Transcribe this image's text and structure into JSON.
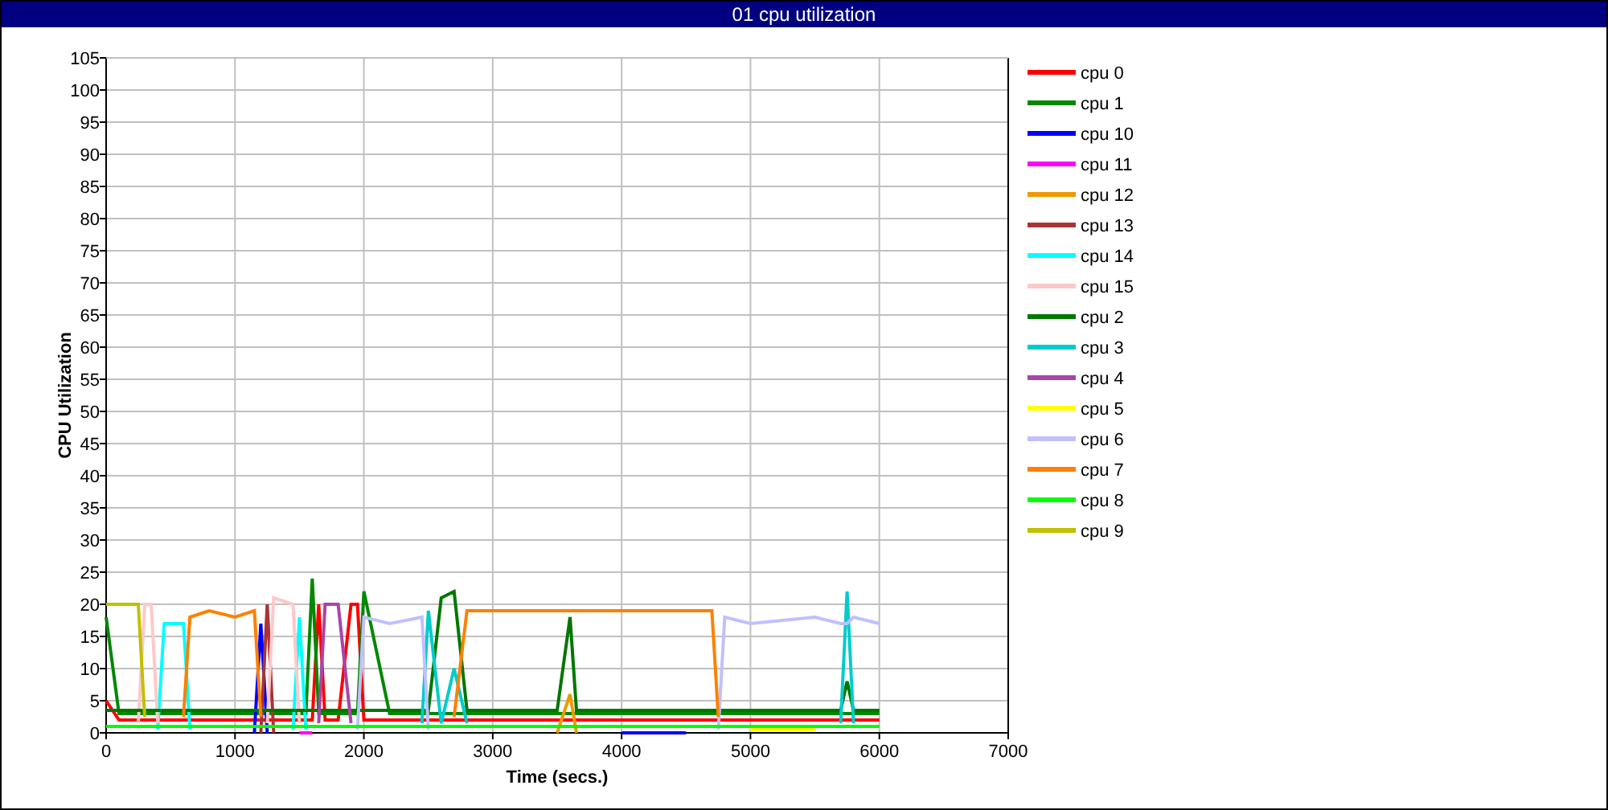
{
  "window": {
    "title": "01 cpu utilization"
  },
  "chart": {
    "chart_data": {
      "type": "line",
      "xlabel": "Time (secs.)",
      "ylabel": "CPU Utilization",
      "x": [
        0,
        100,
        250,
        300,
        350,
        400,
        450,
        600,
        650,
        800,
        1000,
        1150,
        1200,
        1250,
        1300,
        1450,
        1500,
        1550,
        1600,
        1650,
        1700,
        1800,
        1900,
        1950,
        2000,
        2200,
        2450,
        2500,
        2600,
        2700,
        2800,
        3000,
        3500,
        3600,
        3650,
        4000,
        4500,
        4700,
        4750,
        4800,
        5000,
        5500,
        5700,
        5750,
        5800,
        6000
      ],
      "xlim": [
        0,
        7000
      ],
      "ylim": [
        0,
        105
      ],
      "xticks": [
        0,
        1000,
        2000,
        3000,
        4000,
        5000,
        6000,
        7000
      ],
      "yticks": [
        0,
        5,
        10,
        15,
        20,
        25,
        30,
        35,
        40,
        45,
        50,
        55,
        60,
        65,
        70,
        75,
        80,
        85,
        90,
        95,
        100,
        105
      ],
      "grid": true,
      "legend": "right",
      "series": [
        {
          "name": "cpu 0",
          "color": "#ff0000",
          "values": [
            5,
            2,
            2,
            2,
            2,
            2,
            2,
            2,
            2,
            2,
            2,
            2,
            2,
            2,
            2,
            2,
            2,
            2,
            2,
            20,
            2,
            2,
            20,
            20,
            2,
            2,
            2,
            2,
            2,
            2,
            2,
            2,
            2,
            2,
            2,
            2,
            2,
            2,
            2,
            2,
            2,
            2,
            2,
            2,
            2,
            2
          ]
        },
        {
          "name": "cpu 1",
          "color": "#008800",
          "values": [
            18,
            3,
            3,
            3,
            3,
            3,
            3,
            3,
            3,
            3,
            3,
            3,
            3,
            3,
            3,
            3,
            3,
            3,
            24,
            3,
            3,
            3,
            3,
            3,
            22,
            3,
            3,
            3,
            3,
            3,
            3,
            3,
            3,
            3,
            3,
            3,
            3,
            3,
            3,
            3,
            3,
            3,
            3,
            3,
            3,
            3
          ]
        },
        {
          "name": "cpu 10",
          "color": "#0000ff",
          "values": [
            null,
            null,
            null,
            null,
            null,
            null,
            null,
            null,
            null,
            null,
            null,
            0,
            17,
            0,
            null,
            null,
            null,
            null,
            null,
            null,
            null,
            null,
            null,
            null,
            null,
            null,
            null,
            null,
            null,
            null,
            null,
            null,
            null,
            null,
            null,
            0,
            0,
            null,
            null,
            null,
            null,
            null,
            null,
            null,
            null,
            null
          ]
        },
        {
          "name": "cpu 11",
          "color": "#ff00ff",
          "values": [
            null,
            null,
            null,
            null,
            null,
            null,
            null,
            null,
            null,
            null,
            null,
            null,
            null,
            null,
            null,
            null,
            0,
            0,
            0,
            null,
            null,
            null,
            null,
            null,
            null,
            null,
            null,
            null,
            null,
            null,
            null,
            null,
            null,
            null,
            null,
            null,
            null,
            null,
            null,
            null,
            null,
            null,
            null,
            null,
            null,
            null
          ]
        },
        {
          "name": "cpu 12",
          "color": "#ee9900",
          "values": [
            null,
            null,
            null,
            null,
            null,
            null,
            null,
            null,
            null,
            null,
            null,
            null,
            null,
            null,
            null,
            null,
            null,
            null,
            null,
            null,
            null,
            null,
            null,
            null,
            null,
            null,
            null,
            null,
            null,
            null,
            null,
            null,
            0,
            6,
            0,
            null,
            null,
            null,
            null,
            null,
            null,
            null,
            null,
            null,
            null,
            null
          ]
        },
        {
          "name": "cpu 13",
          "color": "#aa3333",
          "values": [
            null,
            null,
            null,
            null,
            null,
            null,
            null,
            null,
            null,
            null,
            null,
            null,
            0,
            20,
            0,
            null,
            null,
            null,
            null,
            null,
            null,
            null,
            null,
            null,
            null,
            null,
            null,
            null,
            null,
            null,
            null,
            null,
            null,
            null,
            null,
            null,
            null,
            null,
            null,
            null,
            null,
            null,
            null,
            null,
            null,
            null
          ]
        },
        {
          "name": "cpu 14",
          "color": "#00ffff",
          "values": [
            null,
            null,
            null,
            null,
            null,
            0.5,
            17,
            17,
            0.5,
            null,
            null,
            null,
            null,
            null,
            null,
            0.5,
            18,
            0.5,
            null,
            null,
            null,
            null,
            null,
            null,
            null,
            null,
            null,
            null,
            null,
            null,
            null,
            null,
            null,
            null,
            null,
            null,
            null,
            null,
            null,
            null,
            null,
            null,
            null,
            null,
            null,
            null
          ]
        },
        {
          "name": "cpu 15",
          "color": "#ffc8c8",
          "values": [
            null,
            null,
            1.5,
            20,
            20,
            1.5,
            null,
            null,
            null,
            null,
            null,
            null,
            null,
            1.5,
            21,
            20,
            1.5,
            null,
            null,
            null,
            null,
            null,
            null,
            null,
            null,
            null,
            null,
            null,
            null,
            null,
            null,
            null,
            null,
            null,
            null,
            null,
            null,
            null,
            null,
            null,
            null,
            null,
            null,
            null,
            null,
            null
          ]
        },
        {
          "name": "cpu 2",
          "color": "#007700",
          "values": [
            3.5,
            3.5,
            3.5,
            3.5,
            3.5,
            3.5,
            3.5,
            3.5,
            3.5,
            3.5,
            3.5,
            3.5,
            3.5,
            3.5,
            3.5,
            3.5,
            3.5,
            3.5,
            3.5,
            3.5,
            3.5,
            3.5,
            3.5,
            3.5,
            3.5,
            3.5,
            3.5,
            3.5,
            21,
            22,
            3.5,
            3.5,
            3.5,
            18,
            3.5,
            3.5,
            3.5,
            3.5,
            3.5,
            3.5,
            3.5,
            3.5,
            3.5,
            8,
            3.5,
            3.5
          ]
        },
        {
          "name": "cpu 3",
          "color": "#00cccc",
          "values": [
            null,
            null,
            null,
            null,
            null,
            null,
            null,
            null,
            null,
            null,
            null,
            null,
            null,
            null,
            null,
            null,
            null,
            null,
            null,
            null,
            null,
            null,
            null,
            null,
            null,
            null,
            1.5,
            19,
            1.5,
            10,
            1.5,
            null,
            null,
            null,
            null,
            null,
            null,
            null,
            null,
            null,
            null,
            null,
            1.5,
            22,
            1.5,
            null
          ]
        },
        {
          "name": "cpu 4",
          "color": "#aa44aa",
          "values": [
            null,
            null,
            null,
            null,
            null,
            null,
            null,
            null,
            null,
            null,
            null,
            null,
            null,
            null,
            null,
            null,
            null,
            null,
            null,
            1.5,
            20,
            20,
            1.5,
            null,
            null,
            null,
            null,
            null,
            null,
            null,
            null,
            null,
            null,
            null,
            null,
            null,
            null,
            null,
            null,
            null,
            null,
            null,
            null,
            null,
            null,
            null
          ]
        },
        {
          "name": "cpu 5",
          "color": "#ffff00",
          "values": [
            null,
            null,
            null,
            null,
            null,
            null,
            null,
            null,
            null,
            null,
            null,
            null,
            null,
            null,
            null,
            null,
            null,
            null,
            null,
            null,
            null,
            null,
            null,
            null,
            null,
            null,
            null,
            null,
            null,
            null,
            null,
            null,
            null,
            null,
            null,
            null,
            null,
            null,
            null,
            null,
            0.5,
            0.5,
            null,
            null,
            null,
            null
          ]
        },
        {
          "name": "cpu 6",
          "color": "#c0c0ff",
          "values": [
            null,
            null,
            null,
            null,
            null,
            null,
            null,
            null,
            null,
            null,
            null,
            null,
            null,
            null,
            null,
            null,
            null,
            null,
            null,
            null,
            null,
            null,
            null,
            0.5,
            18,
            17,
            18,
            0.5,
            null,
            null,
            null,
            null,
            null,
            null,
            null,
            null,
            null,
            null,
            0.5,
            18,
            17,
            18,
            17,
            17,
            18,
            17
          ]
        },
        {
          "name": "cpu 7",
          "color": "#ff8000",
          "values": [
            null,
            null,
            null,
            null,
            null,
            null,
            null,
            2.5,
            18,
            19,
            18,
            19,
            2.5,
            null,
            null,
            null,
            null,
            null,
            null,
            null,
            null,
            null,
            null,
            null,
            null,
            null,
            null,
            null,
            null,
            2.5,
            19,
            19,
            19,
            19,
            19,
            19,
            19,
            19,
            2.5,
            null,
            null,
            null,
            null,
            null,
            null,
            null
          ]
        },
        {
          "name": "cpu 8",
          "color": "#00ff00",
          "values": [
            1,
            1,
            1,
            1,
            1,
            1,
            1,
            1,
            1,
            1,
            1,
            1,
            1,
            1,
            1,
            1,
            1,
            1,
            1,
            1,
            1,
            1,
            1,
            1,
            1,
            1,
            1,
            1,
            1,
            1,
            1,
            1,
            1,
            1,
            1,
            1,
            1,
            1,
            1,
            1,
            1,
            1,
            1,
            1,
            1,
            1
          ]
        },
        {
          "name": "cpu 9",
          "color": "#c0c000",
          "values": [
            20,
            20,
            20,
            2.5,
            null,
            null,
            null,
            null,
            null,
            null,
            null,
            null,
            null,
            null,
            null,
            null,
            null,
            null,
            null,
            null,
            null,
            null,
            null,
            null,
            null,
            null,
            null,
            null,
            null,
            null,
            null,
            null,
            null,
            null,
            null,
            null,
            null,
            null,
            null,
            null,
            null,
            null,
            null,
            null,
            null,
            null
          ]
        }
      ]
    }
  }
}
